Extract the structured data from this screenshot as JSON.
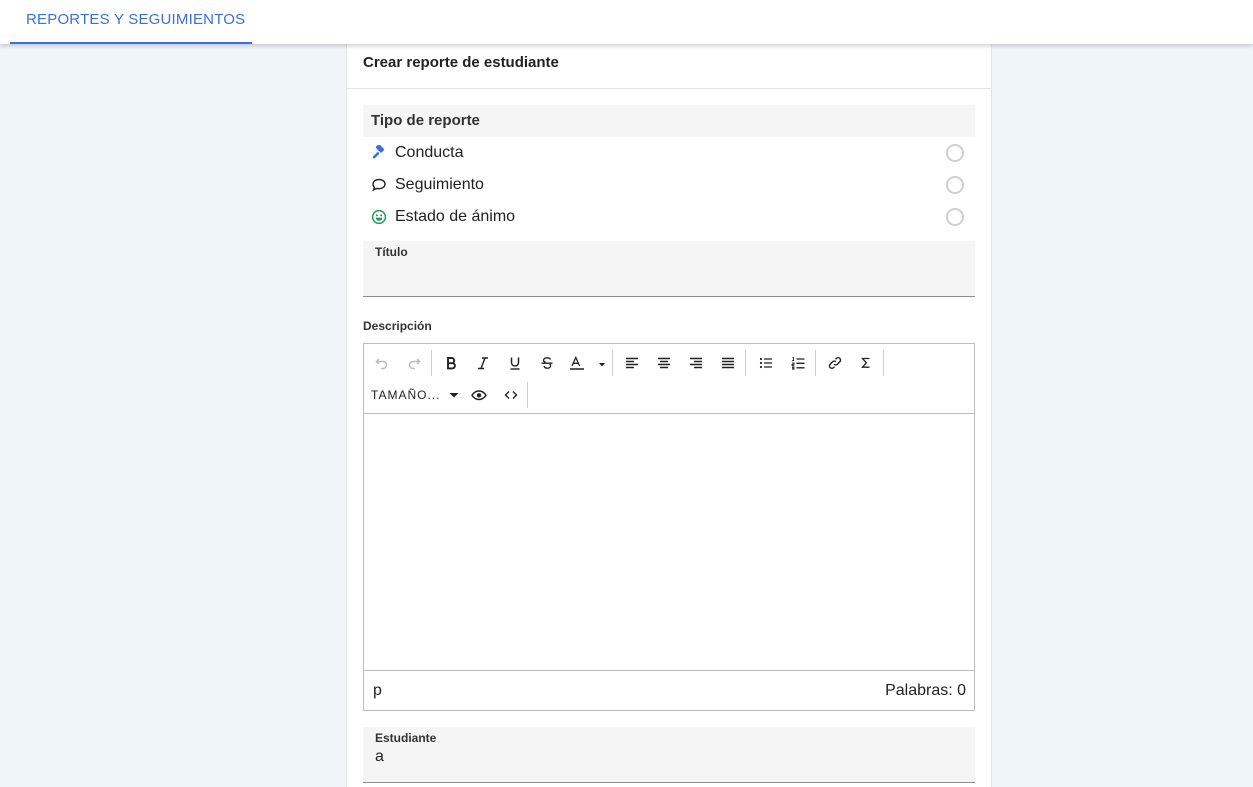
{
  "header": {
    "tab_label": "REPORTES Y SEGUIMIENTOS"
  },
  "card": {
    "title": "Crear reporte de estudiante"
  },
  "report_type": {
    "heading": "Tipo de reporte",
    "options": [
      {
        "label": "Conducta",
        "icon": "gavel-icon",
        "color": "#3b6fe0"
      },
      {
        "label": "Seguimiento",
        "icon": "speech-bubble-icon",
        "color": "#222222"
      },
      {
        "label": "Estado de ánimo",
        "icon": "smiley-icon",
        "color": "#1e9e5a"
      }
    ]
  },
  "title_field": {
    "label": "Título",
    "value": ""
  },
  "description": {
    "label": "Descripción",
    "toolbar": {
      "font_size_label": "TAMAÑO..."
    },
    "status_path": "p",
    "word_count": "Palabras: 0"
  },
  "student_field": {
    "label": "Estudiante",
    "value": "a"
  },
  "colors": {
    "accent": "#3b6fe0",
    "background": "#f0f5fa"
  }
}
